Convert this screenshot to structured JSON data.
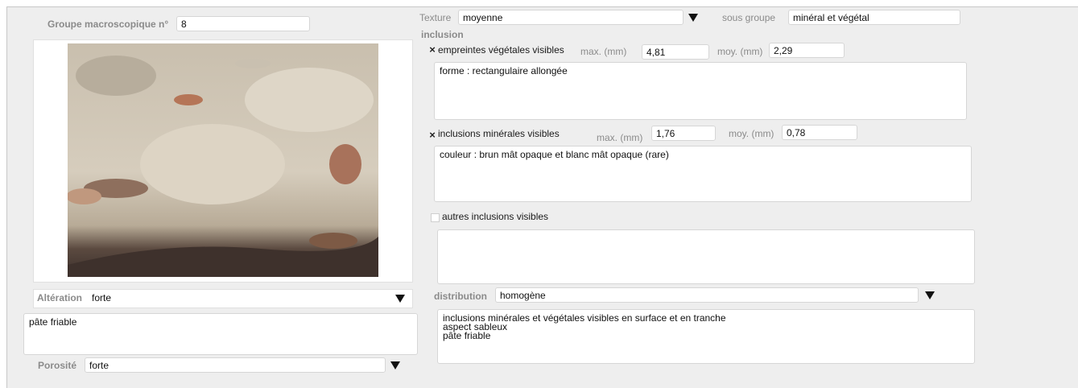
{
  "groupe": {
    "label": "Groupe macroscopique n°",
    "value": "8"
  },
  "texture": {
    "label": "Texture",
    "value": "moyenne"
  },
  "sous_groupe": {
    "label": "sous groupe",
    "value": "minéral et végétal"
  },
  "inclusion": {
    "title": "inclusion",
    "vegetal": {
      "checked": true,
      "label": "empreintes végétales visibles",
      "max_label": "max. (mm)",
      "max_value": "4,81",
      "moy_label": "moy. (mm)",
      "moy_value": "2,29",
      "note": "forme : rectangulaire allongée"
    },
    "mineral": {
      "checked": true,
      "label": "inclusions minérales visibles",
      "max_label": "max. (mm)",
      "max_value": "1,76",
      "moy_label": "moy. (mm)",
      "moy_value": "0,78",
      "note": "couleur : brun mât opaque et blanc mât opaque (rare)"
    },
    "autres": {
      "checked": false,
      "label": "autres inclusions visibles",
      "note": ""
    }
  },
  "alteration": {
    "label": "Altération",
    "value": "forte",
    "note": "pâte friable"
  },
  "porosite": {
    "label": "Porosité",
    "value": "forte"
  },
  "distribution": {
    "label": "distribution",
    "value": "homogène",
    "note": "inclusions minérales et végétales visibles en surface et en tranche\naspect sableux\npâte friable"
  },
  "icons": {
    "dropdown": "triangle-down-icon",
    "check": "x-check-icon"
  },
  "colors": {
    "background": "#eeeeee",
    "label": "#8b8b8b",
    "field": "#ffffff"
  }
}
